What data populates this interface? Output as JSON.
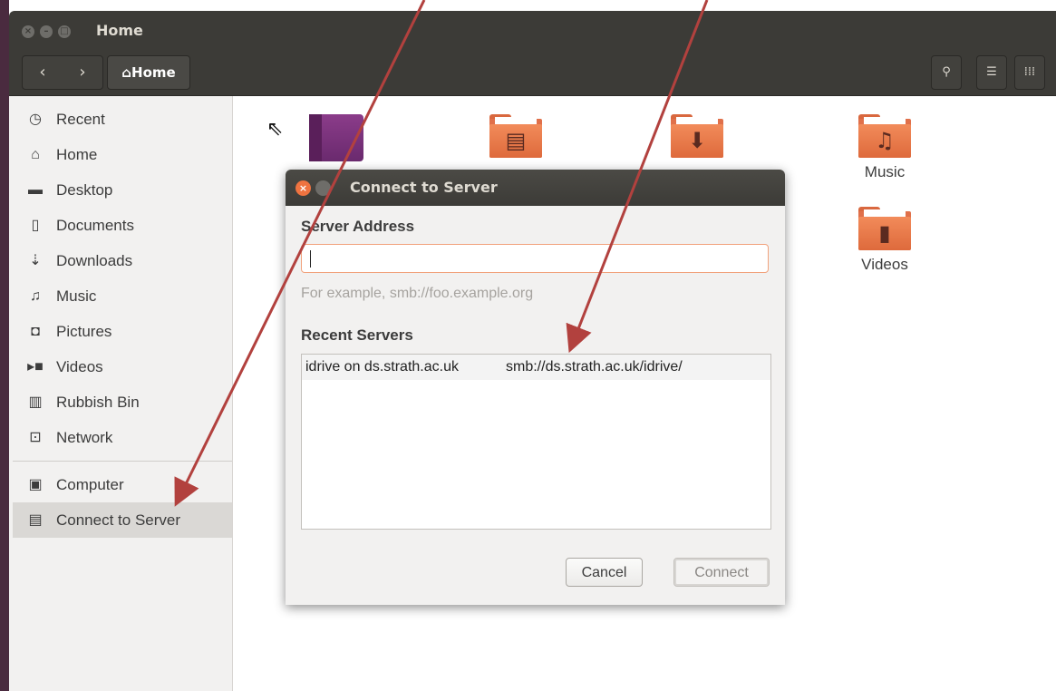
{
  "window": {
    "title": "Home",
    "close_glyph": "×",
    "minimize_glyph": "–",
    "maximize_glyph": "□"
  },
  "toolbar": {
    "back_icon": "‹",
    "forward_icon": "›",
    "path_label": "⌂Home",
    "search_icon": "⚲",
    "list_view_icon": "☰",
    "grid_view_icon": "⁞⁞⁞"
  },
  "sidebar": {
    "items": [
      {
        "label": "Recent",
        "icon": "◷"
      },
      {
        "label": "Home",
        "icon": "⌂"
      },
      {
        "label": "Desktop",
        "icon": "▬"
      },
      {
        "label": "Documents",
        "icon": "▯"
      },
      {
        "label": "Downloads",
        "icon": "⇣"
      },
      {
        "label": "Music",
        "icon": "♫"
      },
      {
        "label": "Pictures",
        "icon": "◘"
      },
      {
        "label": "Videos",
        "icon": "▸■"
      },
      {
        "label": "Rubbish Bin",
        "icon": "▥"
      },
      {
        "label": "Network",
        "icon": "⊡"
      },
      {
        "label": "Computer",
        "icon": "▣"
      },
      {
        "label": "Connect to Server",
        "icon": "▤"
      }
    ]
  },
  "folders": {
    "music": {
      "label": "Music",
      "glyph": "♫"
    },
    "videos": {
      "label": "Videos",
      "glyph": "▮"
    },
    "downloads": {
      "glyph": "⬇"
    },
    "documents": {
      "glyph": "▤"
    }
  },
  "dialog": {
    "title": "Connect to Server",
    "close_glyph": "×",
    "server_address_label": "Server Address",
    "server_address_value": "",
    "hint": "For example, smb://foo.example.org",
    "recent_servers_label": "Recent Servers",
    "recent_servers": [
      {
        "name": "idrive on ds.strath.ac.uk",
        "url": "smb://ds.strath.ac.uk/idrive/"
      }
    ],
    "cancel_label": "Cancel",
    "connect_label": "Connect"
  },
  "annotation": {
    "arrow_color": "#b2413e"
  }
}
